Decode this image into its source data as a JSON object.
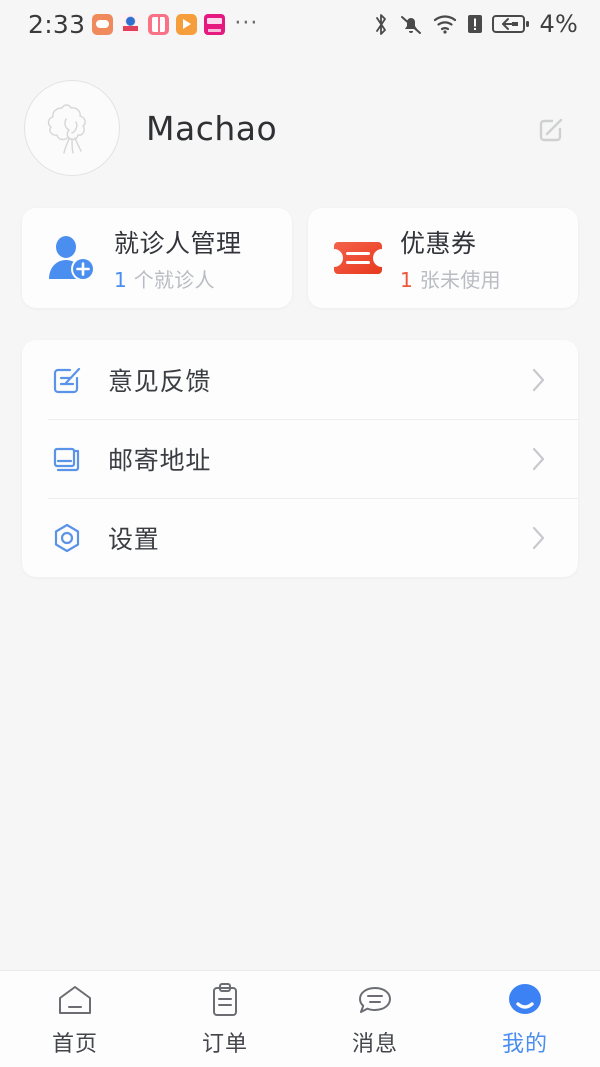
{
  "statusbar": {
    "time": "2:33",
    "app_icons": [
      "message-icon",
      "flower-icon",
      "book-icon",
      "play-icon",
      "pink-app-icon"
    ],
    "overflow": "···",
    "right_icons": [
      "bluetooth-icon",
      "bell-muted-icon",
      "wifi-icon",
      "alert-icon",
      "battery-charging-icon"
    ],
    "battery": "4%"
  },
  "profile": {
    "username": "Machao",
    "avatar_alt": "avatar-sketch",
    "edit_icon": "edit-square-icon"
  },
  "cards": [
    {
      "icon": "user-add-icon",
      "title": "就诊人管理",
      "sub_num": "1",
      "sub_text": " 个就诊人",
      "num_color": "#4a8ef0"
    },
    {
      "icon": "coupon-ticket-icon",
      "title": "优惠券",
      "sub_num": "1",
      "sub_text": " 张未使用",
      "num_color": "#f0563a"
    }
  ],
  "menu": [
    {
      "icon": "feedback-note-icon",
      "label": "意见反馈",
      "chevron": "chevron-right-icon"
    },
    {
      "icon": "mail-address-book-icon",
      "label": "邮寄地址",
      "chevron": "chevron-right-icon"
    },
    {
      "icon": "settings-hex-icon",
      "label": "设置",
      "chevron": "chevron-right-icon"
    }
  ],
  "tabs": [
    {
      "icon": "home-icon",
      "label": "首页",
      "active": false
    },
    {
      "icon": "clipboard-order-icon",
      "label": "订单",
      "active": false
    },
    {
      "icon": "chat-bubble-icon",
      "label": "消息",
      "active": false
    },
    {
      "icon": "profile-circle-icon",
      "label": "我的",
      "active": true
    }
  ],
  "colors": {
    "background": "#f6f6f6",
    "card": "#fdfdfd",
    "accent_blue": "#4a8ef0",
    "accent_red": "#f0563a",
    "text_primary": "#32343a",
    "text_muted": "#b9bcc2"
  }
}
